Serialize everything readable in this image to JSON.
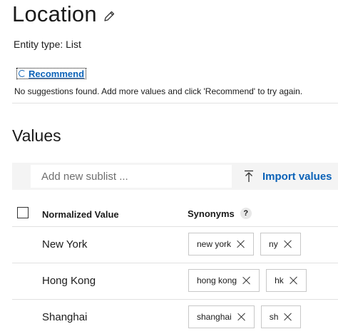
{
  "header": {
    "title": "Location",
    "entity_type": "Entity type: List"
  },
  "recommend": {
    "label": "Recommend",
    "no_suggestions": "No suggestions found. Add more values and click 'Recommend' to try again."
  },
  "values": {
    "heading": "Values",
    "sublist_placeholder": "Add new sublist ...",
    "import_label": "Import values",
    "columns": {
      "normalized": "Normalized Value",
      "synonyms": "Synonyms",
      "help": "?"
    },
    "rows": [
      {
        "value": "New York",
        "synonyms": [
          "new york",
          "ny"
        ]
      },
      {
        "value": "Hong Kong",
        "synonyms": [
          "hong kong",
          "hk"
        ]
      },
      {
        "value": "Shanghai",
        "synonyms": [
          "shanghai",
          "sh"
        ]
      }
    ]
  },
  "colors": {
    "accent": "#0b62b8",
    "toolbar_bg": "#f4f4f4",
    "divider": "#e1e1e1"
  },
  "icons": [
    "edit-pencil-icon",
    "refresh-icon",
    "import-icon",
    "help-icon",
    "remove-icon"
  ]
}
